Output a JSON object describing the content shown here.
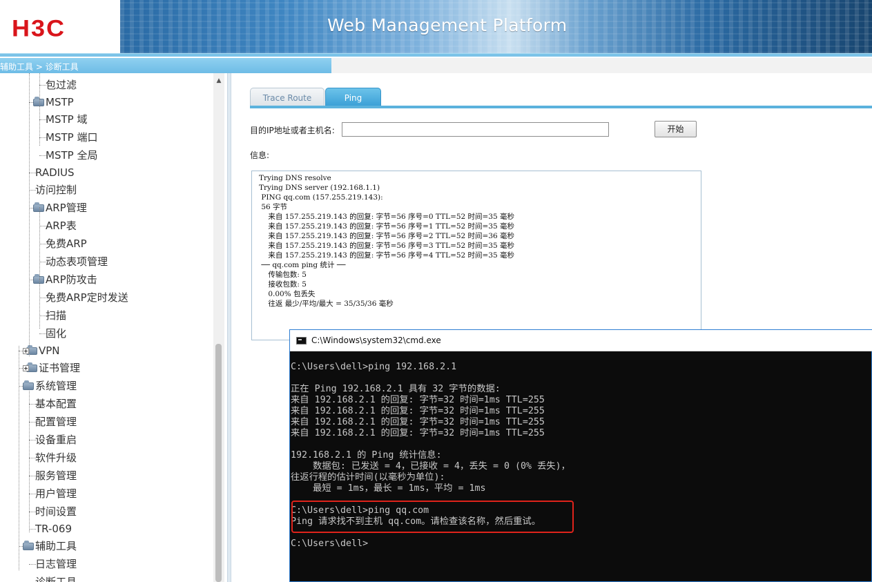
{
  "header": {
    "logo": "H3C",
    "title": "Web Management Platform"
  },
  "breadcrumb": "辅助工具 > 诊断工具",
  "nav": {
    "items": [
      {
        "label": "包过滤",
        "level": 3,
        "type": "leaf"
      },
      {
        "label": "MSTP",
        "level": 2,
        "type": "folder-open"
      },
      {
        "label": "MSTP 域",
        "level": 3,
        "type": "leaf"
      },
      {
        "label": "MSTP 端口",
        "level": 3,
        "type": "leaf"
      },
      {
        "label": "MSTP 全局",
        "level": 3,
        "type": "leaf"
      },
      {
        "label": "RADIUS",
        "level": 2,
        "type": "leaf"
      },
      {
        "label": "访问控制",
        "level": 2,
        "type": "leaf"
      },
      {
        "label": "ARP管理",
        "level": 2,
        "type": "folder-open"
      },
      {
        "label": "ARP表",
        "level": 3,
        "type": "leaf"
      },
      {
        "label": "免费ARP",
        "level": 3,
        "type": "leaf"
      },
      {
        "label": "动态表项管理",
        "level": 3,
        "type": "leaf"
      },
      {
        "label": "ARP防攻击",
        "level": 2,
        "type": "folder-open"
      },
      {
        "label": "免费ARP定时发送",
        "level": 3,
        "type": "leaf"
      },
      {
        "label": "扫描",
        "level": 3,
        "type": "leaf"
      },
      {
        "label": "固化",
        "level": 3,
        "type": "leaf"
      },
      {
        "label": "VPN",
        "level": 1,
        "type": "folder-closed"
      },
      {
        "label": "证书管理",
        "level": 1,
        "type": "folder-closed"
      },
      {
        "label": "系统管理",
        "level": 1,
        "type": "folder-open"
      },
      {
        "label": "基本配置",
        "level": 2,
        "type": "leaf"
      },
      {
        "label": "配置管理",
        "level": 2,
        "type": "leaf"
      },
      {
        "label": "设备重启",
        "level": 2,
        "type": "leaf"
      },
      {
        "label": "软件升级",
        "level": 2,
        "type": "leaf"
      },
      {
        "label": "服务管理",
        "level": 2,
        "type": "leaf"
      },
      {
        "label": "用户管理",
        "level": 2,
        "type": "leaf"
      },
      {
        "label": "时间设置",
        "level": 2,
        "type": "leaf"
      },
      {
        "label": "TR-069",
        "level": 2,
        "type": "leaf"
      },
      {
        "label": "辅助工具",
        "level": 1,
        "type": "folder-open"
      },
      {
        "label": "日志管理",
        "level": 2,
        "type": "leaf"
      },
      {
        "label": "诊断工具",
        "level": 2,
        "type": "leaf"
      }
    ]
  },
  "tabs": [
    {
      "label": "Trace Route",
      "active": false
    },
    {
      "label": "Ping",
      "active": true
    }
  ],
  "form": {
    "dest_label": "目的IP地址或者主机名:",
    "dest_value": "",
    "start_button": "开始",
    "info_label": "信息:"
  },
  "info_output": [
    "Trying DNS resolve",
    "Trying DNS server (192.168.1.1)",
    " PING qq.com (157.255.219.143):",
    " 56 字节",
    "    来自 157.255.219.143 的回复: 字节=56 序号=0 TTL=52 时间=35 毫秒",
    "    来自 157.255.219.143 的回复: 字节=56 序号=1 TTL=52 时间=35 毫秒",
    "    来自 157.255.219.143 的回复: 字节=56 序号=2 TTL=52 时间=36 毫秒",
    "    来自 157.255.219.143 的回复: 字节=56 序号=3 TTL=52 时间=35 毫秒",
    "    来自 157.255.219.143 的回复: 字节=56 序号=4 TTL=52 时间=35 毫秒",
    "",
    " ── qq.com ping 统计 ──",
    "    传输包数: 5",
    "    接收包数: 5",
    "    0.00% 包丢失",
    "    往返 最少/平均/最大 = 35/35/36 毫秒"
  ],
  "cmd": {
    "title": "C:\\Windows\\system32\\cmd.exe",
    "lines": [
      "C:\\Users\\dell>ping 192.168.2.1",
      "",
      "正在 Ping 192.168.2.1 具有 32 字节的数据:",
      "来自 192.168.2.1 的回复: 字节=32 时间=1ms TTL=255",
      "来自 192.168.2.1 的回复: 字节=32 时间=1ms TTL=255",
      "来自 192.168.2.1 的回复: 字节=32 时间=1ms TTL=255",
      "来自 192.168.2.1 的回复: 字节=32 时间=1ms TTL=255",
      "",
      "192.168.2.1 的 Ping 统计信息:",
      "    数据包: 已发送 = 4，已接收 = 4，丢失 = 0 (0% 丢失)，",
      "往返行程的估计时间(以毫秒为单位):",
      "    最短 = 1ms，最长 = 1ms，平均 = 1ms",
      "",
      "C:\\Users\\dell>ping qq.com",
      "Ping 请求找不到主机 qq.com。请检查该名称，然后重试。",
      "",
      "C:\\Users\\dell>"
    ]
  },
  "colors": {
    "brand_red": "#d9151b",
    "header_blue": "#1b4f7c",
    "tab_active": "#3a9fd6",
    "highlight_red": "#e0231b",
    "cmd_bg": "#0c0c0c"
  }
}
